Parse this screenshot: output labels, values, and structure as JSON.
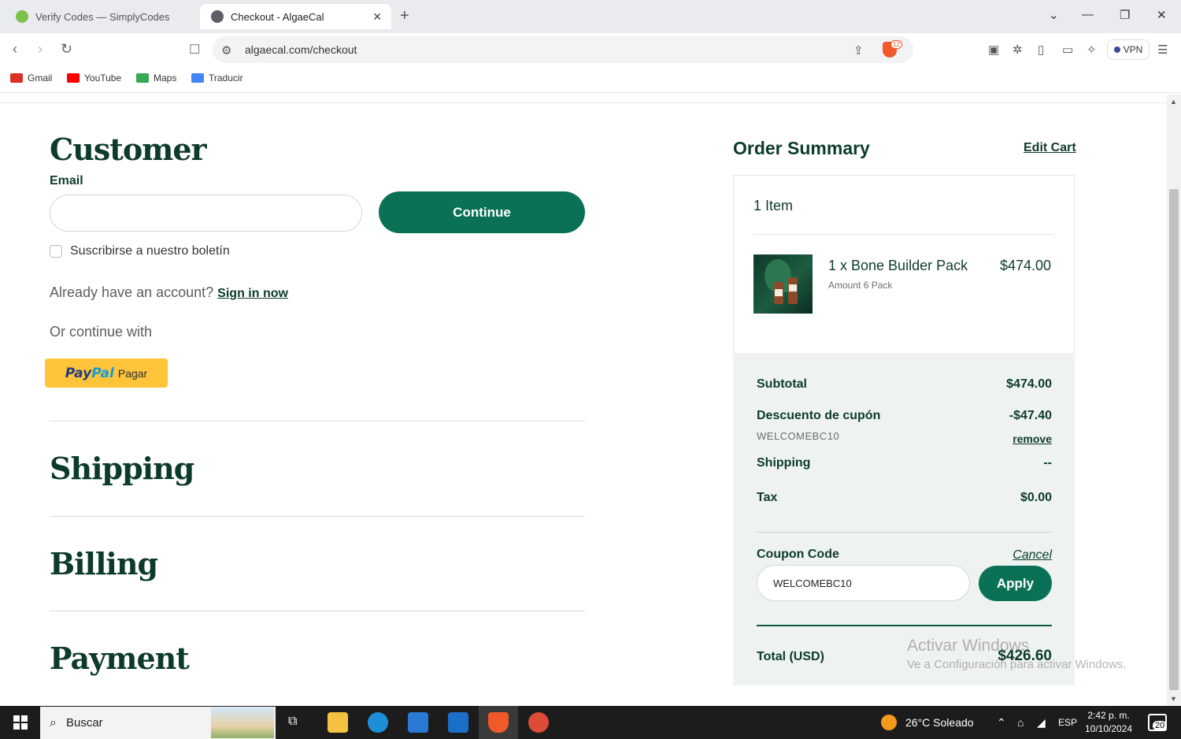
{
  "browser": {
    "tabs": [
      {
        "title": "Verify Codes — SimplyCodes",
        "active": false
      },
      {
        "title": "Checkout - AlgaeCal",
        "active": true
      }
    ],
    "url": "algaecal.com/checkout",
    "shield_count": "12",
    "vpn_label": "VPN",
    "bookmarks": [
      {
        "label": "Gmail",
        "color": "#d93025"
      },
      {
        "label": "YouTube",
        "color": "#ff0000"
      },
      {
        "label": "Maps",
        "color": "#34a853"
      },
      {
        "label": "Traducir",
        "color": "#4285f4"
      }
    ]
  },
  "checkout": {
    "customer": {
      "title": "Customer",
      "email_label": "Email",
      "email_value": "",
      "continue_label": "Continue",
      "newsletter_label": "Suscribirse a nuestro boletín",
      "newsletter_checked": false,
      "account_prompt": "Already have an account?",
      "sign_in_label": "Sign in now",
      "or_continue": "Or continue with",
      "paypal": {
        "pay": "Pay",
        "pal": "Pal",
        "action": "Pagar"
      }
    },
    "sections": [
      "Shipping",
      "Billing",
      "Payment"
    ]
  },
  "order_summary": {
    "title": "Order Summary",
    "edit_cart": "Edit Cart",
    "items_count": "1 Item",
    "product": {
      "name": "1 x Bone Builder Pack",
      "price": "$474.00",
      "variant": "Amount 6 Pack"
    },
    "subtotal": {
      "label": "Subtotal",
      "value": "$474.00"
    },
    "discount": {
      "label": "Descuento de cupón",
      "value": "-$47.40",
      "code": "WELCOMEBC10",
      "remove": "remove"
    },
    "shipping": {
      "label": "Shipping",
      "value": "--"
    },
    "tax": {
      "label": "Tax",
      "value": "$0.00"
    },
    "coupon": {
      "label": "Coupon Code",
      "cancel": "Cancel",
      "value": "WELCOMEBC10",
      "apply": "Apply"
    },
    "total": {
      "label": "Total (USD)",
      "value": "$426.60"
    }
  },
  "watermark": {
    "line1": "Activar Windows",
    "line2": "Ve a Configuración para activar Windows."
  },
  "taskbar": {
    "search": "Buscar",
    "weather": "26°C  Soleado",
    "language": "ESP",
    "time": "2:42 p. m.",
    "date": "10/10/2024",
    "notifications": "20"
  },
  "colors": {
    "brand_green": "#0b7156",
    "dark_green": "#0d3b2a",
    "paypal_yellow": "#ffc439",
    "summary_bg": "#eef3f1"
  }
}
